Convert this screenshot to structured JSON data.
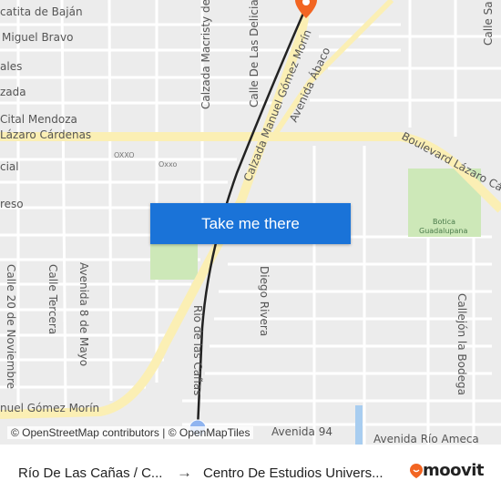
{
  "map": {
    "street_labels": {
      "catita": "catita de Baján",
      "miguel_bravo": "Miguel Bravo",
      "ales": "ales",
      "zada": "zada",
      "cital": "Cital Mendoza",
      "lazaro": "Lázaro Cárdenas",
      "cial": "cial",
      "reso": "reso",
      "macristy": "Calzada Macristy de",
      "delicias": "Calle De Las Delicias",
      "gomez_morin_diag": "Calzada Manuel Gómez Morín",
      "abaco": "Avenida Ábaco",
      "boulevard": "Boulevard Lázaro Cárdenas",
      "calle_sa": "Calle Sa",
      "calle20": "Calle 20 de Noviembre",
      "tercera": "Calle Tercera",
      "av8mayo": "Avenida 8 de Mayo",
      "rio_canas": "Río de las Cañas",
      "diego_rivera": "Diego Rivera",
      "bodega": "Callejón la Bodega",
      "gomez_morin_bottom": "nuel Gómez Morín",
      "av94": "Avenida 94",
      "rio_ameca": "Avenida Río Ameca"
    },
    "poi": {
      "oxxo1": "OXXO",
      "oxxo2": "Oxxo",
      "botica1": "Botica",
      "botica2": "Guadalupana"
    },
    "colors": {
      "route": "#222222",
      "major_road": "#fbefb4",
      "destination_pin": "#f26522",
      "origin_dot": "#8fb4f0",
      "park": "#cde8b8"
    }
  },
  "cta_button": {
    "label": "Take me there",
    "color": "#1a73d8"
  },
  "attribution": "© OpenStreetMap contributors | © OpenMapTiles",
  "footer": {
    "from": "Río De Las Cañas / C...",
    "arrow": "→",
    "to": "Centro De Estudios Univers...",
    "brand": "moovit",
    "brand_color": "#f26522"
  }
}
